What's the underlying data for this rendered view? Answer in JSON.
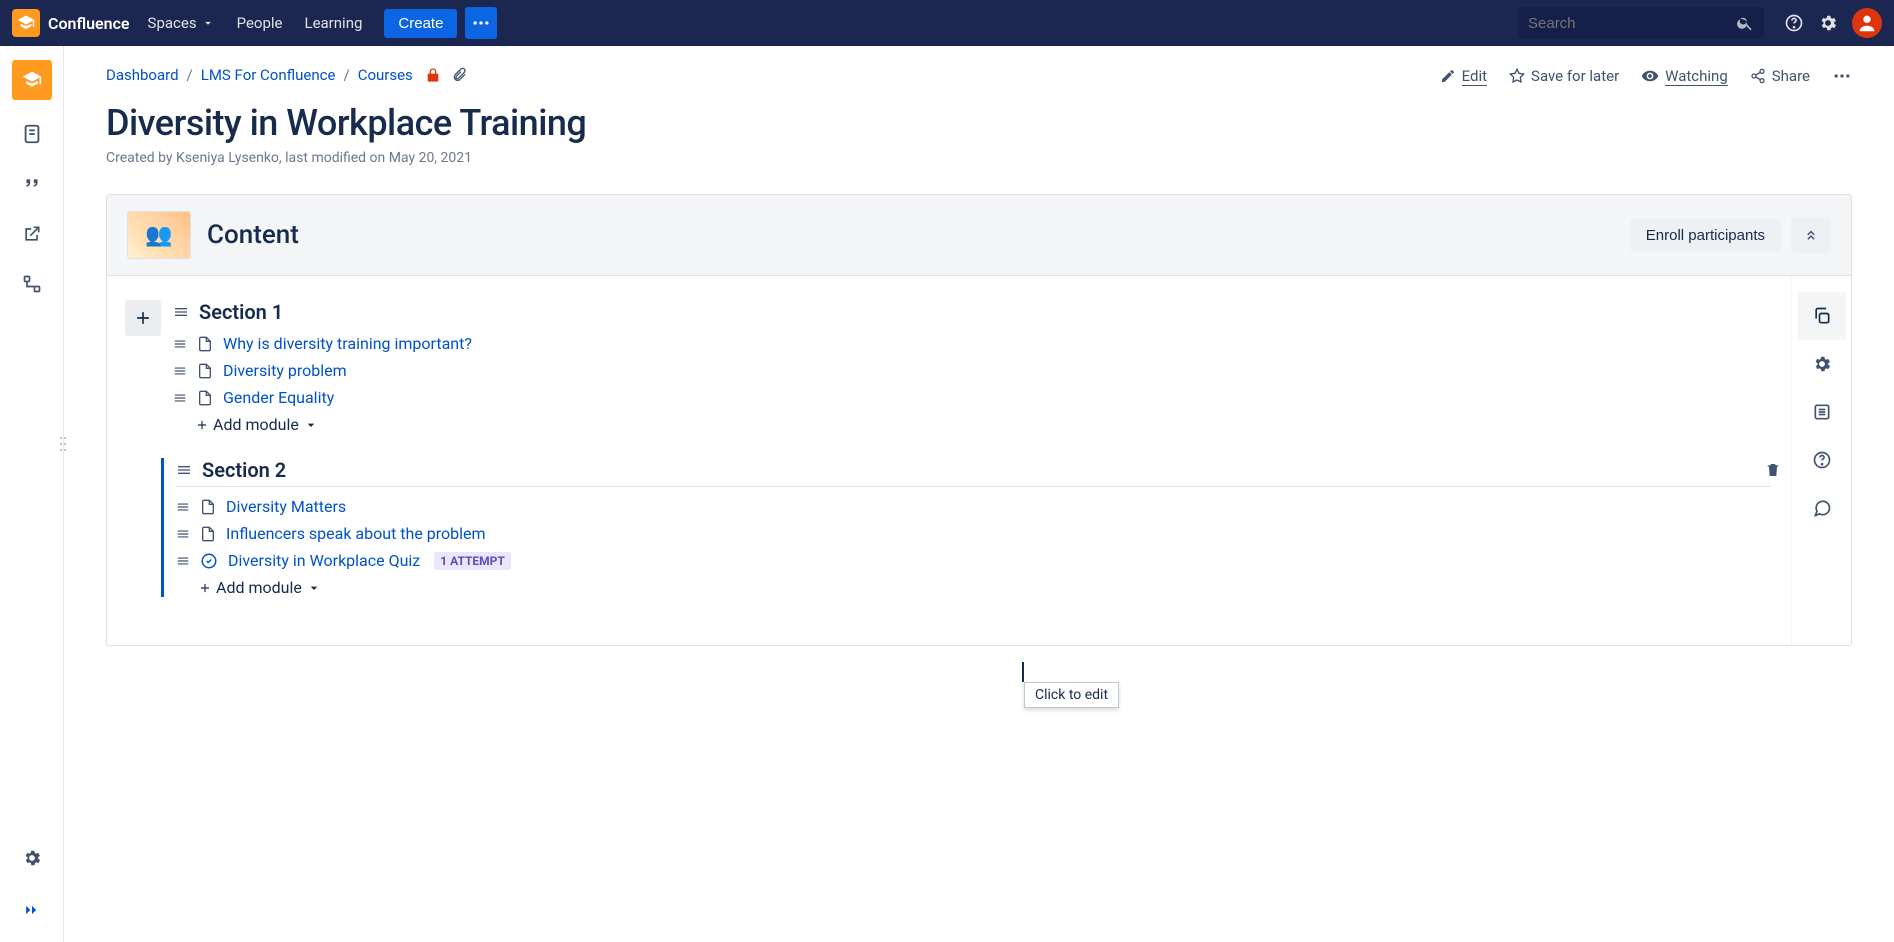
{
  "topnav": {
    "brand": "Confluence",
    "spaces": "Spaces",
    "people": "People",
    "learning": "Learning",
    "create": "Create",
    "search_placeholder": "Search"
  },
  "breadcrumbs": {
    "dashboard": "Dashboard",
    "space": "LMS For Confluence",
    "courses": "Courses"
  },
  "page_actions": {
    "edit": "Edit",
    "save": "Save for later",
    "watching": "Watching",
    "share": "Share"
  },
  "page": {
    "title": "Diversity in Workplace Training",
    "byline": "Created by Kseniya Lysenko, last modified on May 20, 2021"
  },
  "content": {
    "heading": "Content",
    "enroll": "Enroll participants",
    "tooltip": "Click to edit",
    "add_module": "Add module",
    "sections": [
      {
        "title": "Section 1",
        "active": false,
        "modules": [
          {
            "type": "page",
            "label": "Why is diversity training important?"
          },
          {
            "type": "page",
            "label": "Diversity problem"
          },
          {
            "type": "page",
            "label": "Gender Equality"
          }
        ]
      },
      {
        "title": "Section 2",
        "active": true,
        "modules": [
          {
            "type": "page",
            "label": "Diversity Matters"
          },
          {
            "type": "page",
            "label": "Influencers speak about the problem"
          },
          {
            "type": "quiz",
            "label": "Diversity in Workplace Quiz",
            "badge": "1 ATTEMPT"
          }
        ]
      }
    ]
  }
}
